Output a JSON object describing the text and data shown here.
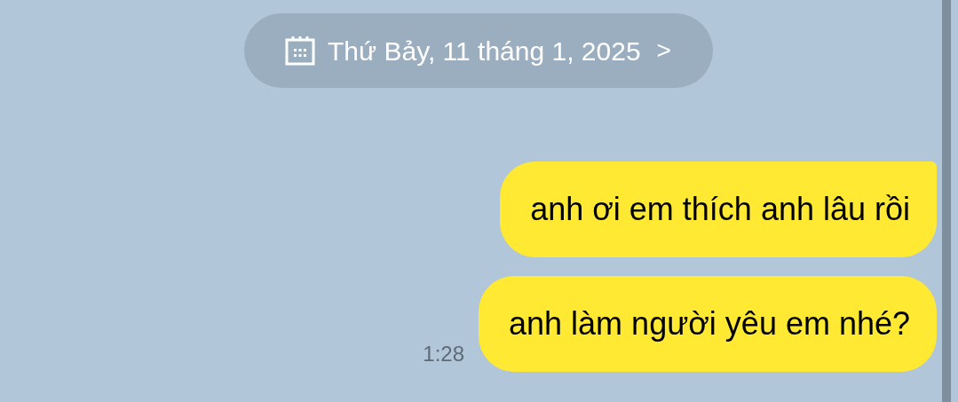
{
  "date_pill": {
    "label": "Thứ Bảy, 11 tháng 1, 2025",
    "chevron": ">"
  },
  "messages": [
    {
      "text": "anh ơi em thích anh lâu rồi",
      "tail": true
    },
    {
      "text": "anh làm người yêu em nhé?",
      "tail": false,
      "time": "1:28"
    }
  ]
}
